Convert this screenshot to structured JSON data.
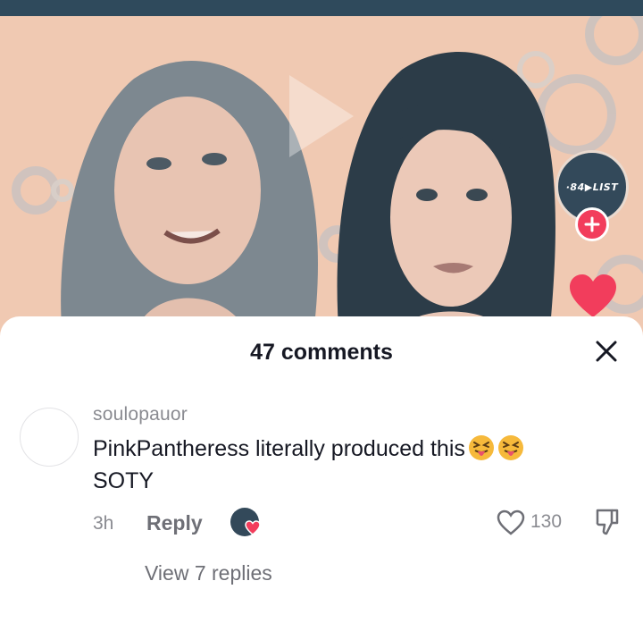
{
  "video": {
    "creator_badge": "·84▶LIST",
    "icons": {
      "play": "play-icon",
      "follow": "plus-icon",
      "like": "heart-icon"
    },
    "colors": {
      "topbar": "#2f4a5c",
      "background": "#f0c9b2",
      "accent": "#f23d5c"
    }
  },
  "sheet": {
    "title": "47 comments",
    "close_icon": "close-icon"
  },
  "comment": {
    "username": "soulopauor",
    "text": "PinkPantheress literally produced this",
    "emojis": [
      "squinting-tongue-emoji",
      "squinting-tongue-emoji"
    ],
    "text_line2": "SOTY",
    "time": "3h",
    "reply_label": "Reply",
    "like_count": "130",
    "view_replies": "View 7 replies"
  }
}
